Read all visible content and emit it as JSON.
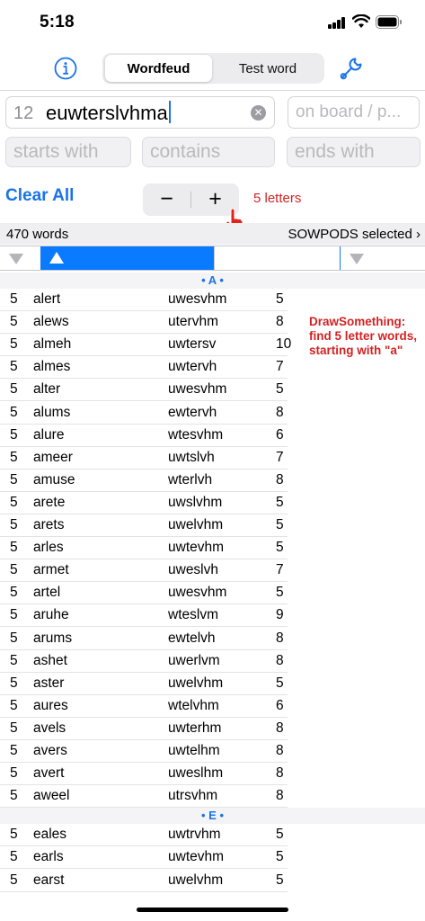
{
  "status": {
    "time": "5:18"
  },
  "toolbar": {
    "info_icon": "info-circle-icon",
    "segments": [
      {
        "label": "Wordfeud",
        "selected": true
      },
      {
        "label": "Test word",
        "selected": false
      }
    ],
    "settings_icon": "wrench-icon"
  },
  "search": {
    "letter_count": "12",
    "letters_value": "euwterslvhma",
    "on_board_placeholder": "on board / p...",
    "starts_with_placeholder": "starts with",
    "contains_placeholder": "contains",
    "ends_with_placeholder": "ends with"
  },
  "controls": {
    "clear_all_label": "Clear All",
    "stepper_minus": "−",
    "stepper_plus": "+",
    "length_label": "5 letters"
  },
  "summary": {
    "word_count": "470 words",
    "dictionary": "SOWPODS selected ›"
  },
  "sections": [
    {
      "header": "• A •",
      "rows": [
        {
          "len": "5",
          "word": "alert",
          "rest": "uwesvhm",
          "score": "5"
        },
        {
          "len": "5",
          "word": "alews",
          "rest": "utervhm",
          "score": "8"
        },
        {
          "len": "5",
          "word": "almeh",
          "rest": "uwtersv",
          "score": "10"
        },
        {
          "len": "5",
          "word": "almes",
          "rest": "uwtervh",
          "score": "7"
        },
        {
          "len": "5",
          "word": "alter",
          "rest": "uwesvhm",
          "score": "5"
        },
        {
          "len": "5",
          "word": "alums",
          "rest": "ewtervh",
          "score": "8"
        },
        {
          "len": "5",
          "word": "alure",
          "rest": "wtesvhm",
          "score": "6"
        },
        {
          "len": "5",
          "word": "ameer",
          "rest": "uwtslvh",
          "score": "7"
        },
        {
          "len": "5",
          "word": "amuse",
          "rest": "wterlvh",
          "score": "8"
        },
        {
          "len": "5",
          "word": "arete",
          "rest": "uwslvhm",
          "score": "5"
        },
        {
          "len": "5",
          "word": "arets",
          "rest": "uwelvhm",
          "score": "5"
        },
        {
          "len": "5",
          "word": "arles",
          "rest": "uwtevhm",
          "score": "5"
        },
        {
          "len": "5",
          "word": "armet",
          "rest": "uweslvh",
          "score": "7"
        },
        {
          "len": "5",
          "word": "artel",
          "rest": "uwesvhm",
          "score": "5"
        },
        {
          "len": "5",
          "word": "aruhe",
          "rest": "wteslvm",
          "score": "9"
        },
        {
          "len": "5",
          "word": "arums",
          "rest": "ewtelvh",
          "score": "8"
        },
        {
          "len": "5",
          "word": "ashet",
          "rest": "uwerlvm",
          "score": "8"
        },
        {
          "len": "5",
          "word": "aster",
          "rest": "uwelvhm",
          "score": "5"
        },
        {
          "len": "5",
          "word": "aures",
          "rest": "wtelvhm",
          "score": "6"
        },
        {
          "len": "5",
          "word": "avels",
          "rest": "uwterhm",
          "score": "8"
        },
        {
          "len": "5",
          "word": "avers",
          "rest": "uwtelhm",
          "score": "8"
        },
        {
          "len": "5",
          "word": "avert",
          "rest": "uweslhm",
          "score": "8"
        },
        {
          "len": "5",
          "word": "aweel",
          "rest": "utrsvhm",
          "score": "8"
        }
      ]
    },
    {
      "header": "• E •",
      "rows": [
        {
          "len": "5",
          "word": "eales",
          "rest": "uwtrvhm",
          "score": "5"
        },
        {
          "len": "5",
          "word": "earls",
          "rest": "uwtevhm",
          "score": "5"
        },
        {
          "len": "5",
          "word": "earst",
          "rest": "uwelvhm",
          "score": "5"
        }
      ]
    }
  ],
  "annotation": "DrawSomething: find 5 letter words, starting with \"a\""
}
